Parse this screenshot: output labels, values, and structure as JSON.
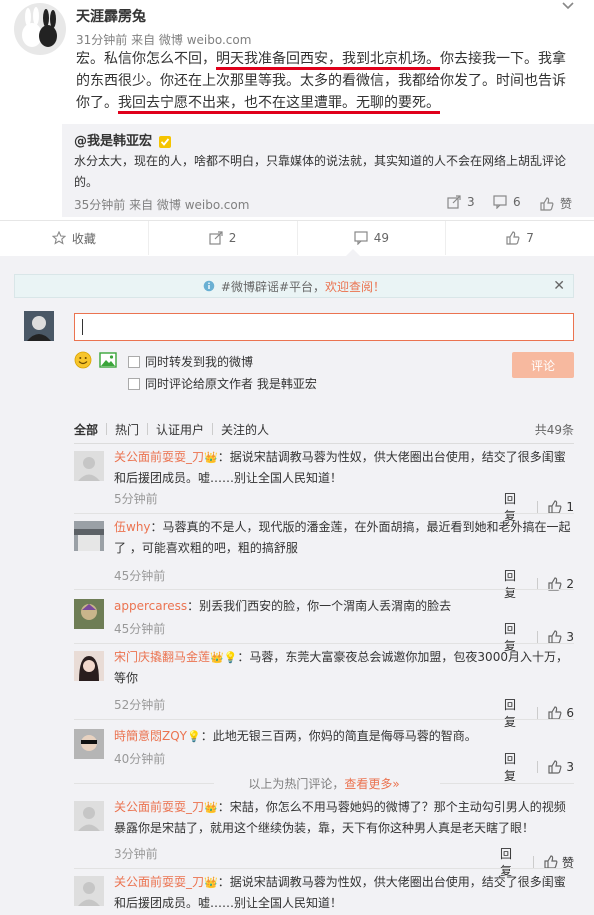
{
  "post": {
    "author": "天涯霹雳兔",
    "meta": "31分钟前 来自 微博 weibo.com",
    "lines": [
      [
        "宏。私信你怎么不回，",
        "明天我准备回西安，我到北京机场。",
        "你去接我一下。我拿"
      ],
      [
        "的东西很少。你还在上次那里等我。太多的看微信，我都给你发了。时间也告诉"
      ],
      [
        "你了。",
        "我回去宁愿不出来，也不在这里遭罪。无聊的要死。",
        ""
      ]
    ]
  },
  "quoted": {
    "author": "@我是韩亚宏",
    "text1": "水分太大，现在的人，啥都不明白，只靠媒体的说法就，其实知道的人不会在网络上胡乱评论",
    "text2": "的。",
    "meta": "35分钟前 来自 微博 weibo.com",
    "share_count": "3",
    "comment_count": "6",
    "like_label": "赞"
  },
  "actions": {
    "favorite": "收藏",
    "forward": "2",
    "comment": "49",
    "like": "7"
  },
  "notice": {
    "prefix": "#微博辟谣#平台，",
    "link": "欢迎查阅！"
  },
  "composer": {
    "value": "",
    "option1": "同时转发到我的微博",
    "option2": "同时评论给原文作者 我是韩亚宏",
    "submit": "评论"
  },
  "filters": {
    "tabs": [
      "全部",
      "热门",
      "认证用户",
      "关注的人"
    ],
    "total": "共49条"
  },
  "comments": [
    {
      "user": "关公面前耍耍_刀",
      "badge": "👑",
      "text1": "：据说宋喆调教马蓉为性奴，供大佬圈出台使用，结交了很多闺蜜",
      "text2": "和后援团成员。嘘……别让全国人民知道！",
      "time": "5分钟前",
      "reply": "回复",
      "likes": "1"
    },
    {
      "user": "伍why",
      "badge": "",
      "text1": "：马蓉真的不是人，现代版的潘金莲，在外面胡搞，最近看到她和老外搞在一起",
      "text2": "了  ，可能喜欢粗的吧，粗的搞舒服",
      "time": "45分钟前",
      "reply": "回复",
      "likes": "2"
    },
    {
      "user": "appercaress",
      "badge": "",
      "text1": "：别丢我们西安的脸，你一个渭南人丢渭南的脸去",
      "text2": "",
      "time": "45分钟前",
      "reply": "回复",
      "likes": "3"
    },
    {
      "user": "宋门庆撬翻马金莲",
      "badge": "👑💡",
      "text1": "：马蓉，东莞大富豪夜总会诚邀你加盟，包夜3000月入十万，",
      "text2": "等你",
      "time": "52分钟前",
      "reply": "回复",
      "likes": "6"
    },
    {
      "user": "時簡意悶ZQY",
      "badge": "💡",
      "text1": "：此地无银三百两，你妈的简直是侮辱马蓉的智商。",
      "text2": "",
      "time": "40分钟前",
      "reply": "回复",
      "likes": "3"
    }
  ],
  "divider": {
    "text": "以上为热门评论，",
    "link": "查看更多»"
  },
  "latest": [
    {
      "user": "关公面前耍耍_刀",
      "badge": "👑",
      "text1": "：宋喆，你怎么不用马蓉她妈的微博了？那个主动勾引男人的视频",
      "text2": "暴露你是宋喆了，就用这个继续伪装，靠，天下有你这种男人真是老天瞎了眼！",
      "time": "3分钟前",
      "reply": "回复",
      "likes": "赞"
    },
    {
      "user": "关公面前耍耍_刀",
      "badge": "👑",
      "text1": "：据说宋喆调教马蓉为性奴，供大佬圈出台使用，结交了很多闺蜜",
      "text2": "和后援团成员。嘘……别让全国人民知道！",
      "time": "",
      "reply": "",
      "likes": ""
    }
  ],
  "colors": {
    "accent": "#eb7350",
    "link": "#eb7350",
    "underline": "#e0001b",
    "bg_light": "#f2f2f5"
  }
}
